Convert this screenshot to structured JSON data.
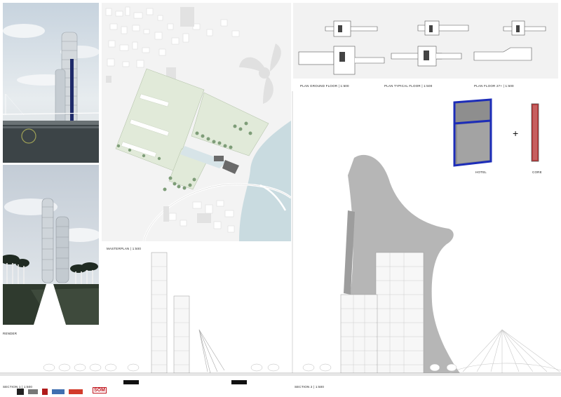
{
  "labels": {
    "render": "RENDER",
    "masterplan": "MASTERPLAN | 1:500",
    "plan_ground": "PLAN GROUND FLOOR | 1:500",
    "plan_typical": "PLAN TYPICAL FLOOR | 1:500",
    "plan_floor": "PLAN FLOOR 27+ | 1:500",
    "hotel": "HOTEL",
    "core": "CORE",
    "plus": "+",
    "section1": "SECTION 1 | 1:500",
    "section2": "SECTION 2 | 1:500"
  },
  "logos": {
    "som": "SOM"
  },
  "colors": {
    "water": "#c9dbe0",
    "park": "#e1ead9",
    "tree": "#7e9d78",
    "building_grey": "#a9a9a9",
    "hotel_blue": "#1d2db8",
    "core_red": "#b63a3a"
  }
}
